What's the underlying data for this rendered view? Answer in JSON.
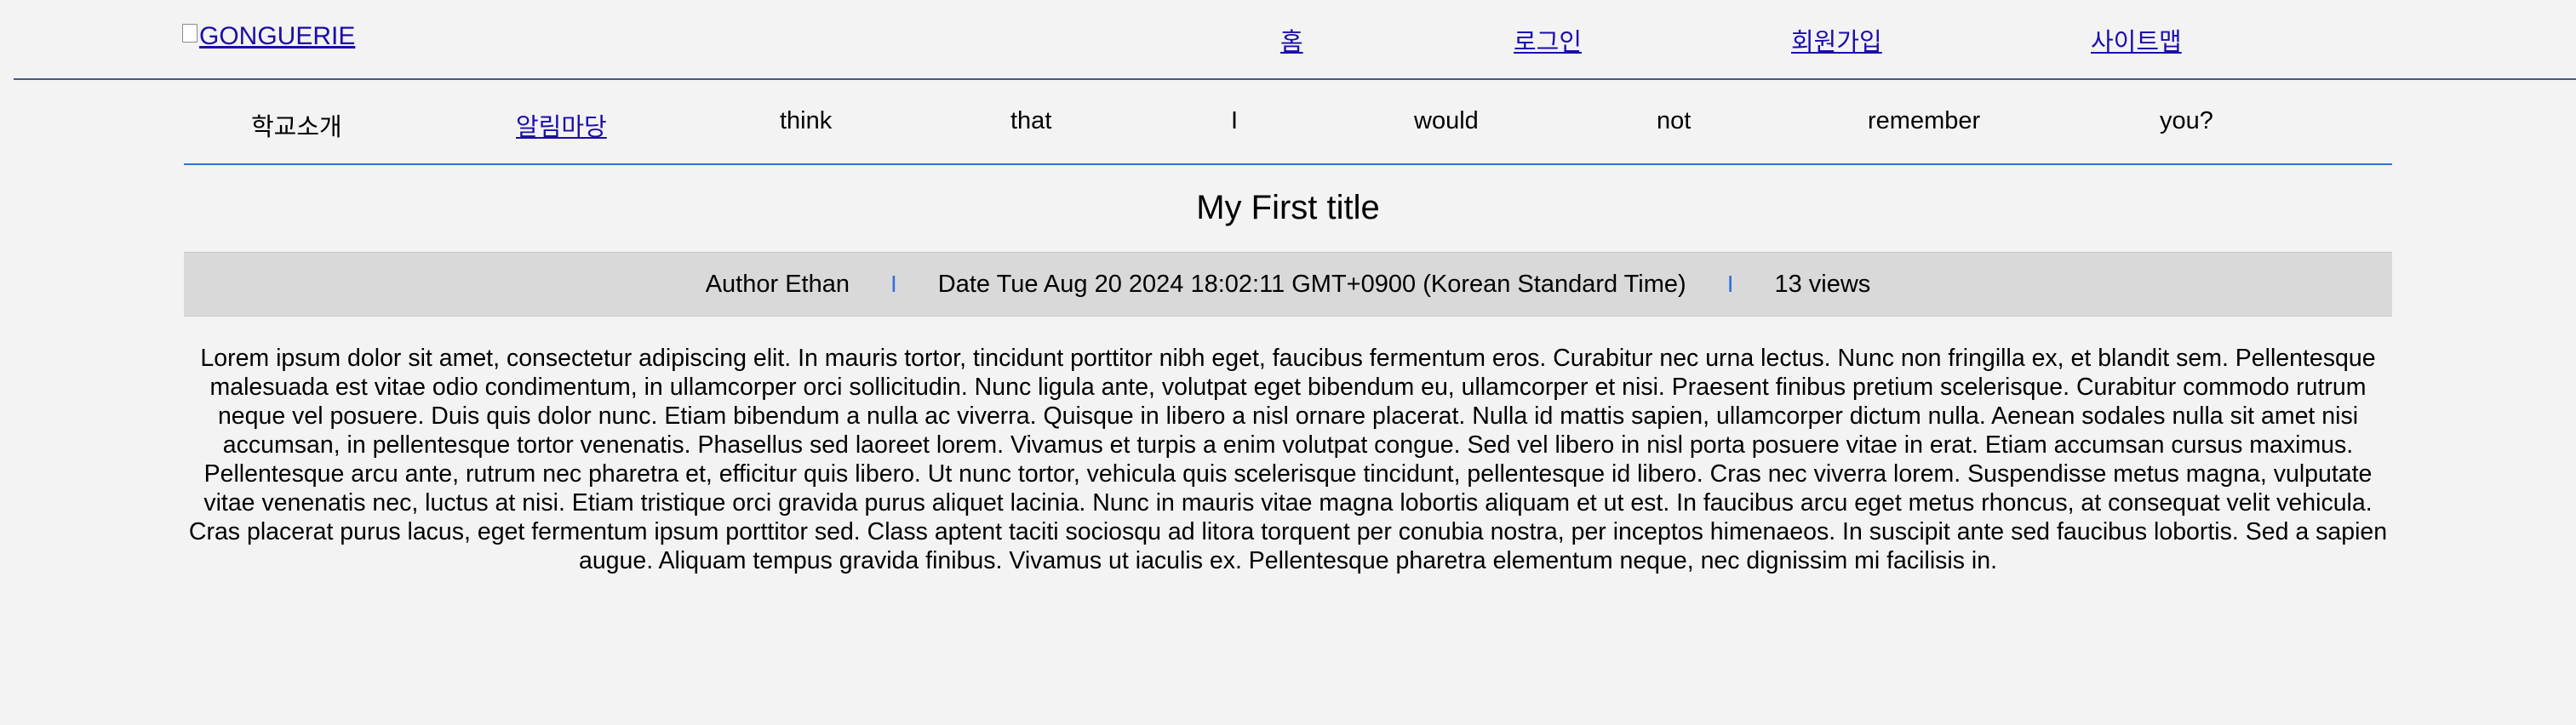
{
  "header": {
    "logo_text": "GONGUERIE",
    "nav": {
      "home": "홈",
      "login": "로그인",
      "signup": "회원가입",
      "sitemap": "사이트맵"
    }
  },
  "category_menu": {
    "items": [
      {
        "label": "학교소개",
        "link": false
      },
      {
        "label": "알림마당",
        "link": true
      },
      {
        "label": "think",
        "link": false
      },
      {
        "label": "that",
        "link": false
      },
      {
        "label": "I",
        "link": false
      },
      {
        "label": "would",
        "link": false
      },
      {
        "label": "not",
        "link": false
      },
      {
        "label": "remember",
        "link": false
      },
      {
        "label": "you?",
        "link": false
      }
    ]
  },
  "post": {
    "title": "My First title",
    "author": "Author Ethan",
    "date": "Date Tue Aug 20 2024 18:02:11 GMT+0900 (Korean Standard Time)",
    "views": "13 views",
    "separator": "I",
    "content": "Lorem ipsum dolor sit amet, consectetur adipiscing elit. In mauris tortor, tincidunt porttitor nibh eget, faucibus fermentum eros. Curabitur nec urna lectus. Nunc non fringilla ex, et blandit sem. Pellentesque malesuada est vitae odio condimentum, in ullamcorper orci sollicitudin. Nunc ligula ante, volutpat eget bibendum eu, ullamcorper et nisi. Praesent finibus pretium scelerisque. Curabitur commodo rutrum neque vel posuere. Duis quis dolor nunc. Etiam bibendum a nulla ac viverra. Quisque in libero a nisl ornare placerat. Nulla id mattis sapien, ullamcorper dictum nulla. Aenean sodales nulla sit amet nisi accumsan, in pellentesque tortor venenatis. Phasellus sed laoreet lorem. Vivamus et turpis a enim volutpat congue. Sed vel libero in nisl porta posuere vitae in erat. Etiam accumsan cursus maximus. Pellentesque arcu ante, rutrum nec pharetra et, efficitur quis libero. Ut nunc tortor, vehicula quis scelerisque tincidunt, pellentesque id libero. Cras nec viverra lorem. Suspendisse metus magna, vulputate vitae venenatis nec, luctus at nisi. Etiam tristique orci gravida purus aliquet lacinia. Nunc in mauris vitae magna lobortis aliquam et ut est. In faucibus arcu eget metus rhoncus, at consequat velit vehicula. Cras placerat purus lacus, eget fermentum ipsum porttitor sed. Class aptent taciti sociosqu ad litora torquent per conubia nostra, per inceptos himenaeos. In suscipit ante sed faucibus lobortis. Sed a sapien augue. Aliquam tempus gravida finibus. Vivamus ut iaculis ex. Pellentesque pharetra elementum neque, nec dignissim mi facilisis in."
  },
  "colors": {
    "background": "#f3f3f3",
    "link": "#1a0dab",
    "accent_line": "#2f6fe0",
    "header_line": "#4a5a7a",
    "meta_bar": "#d9d9d9"
  }
}
